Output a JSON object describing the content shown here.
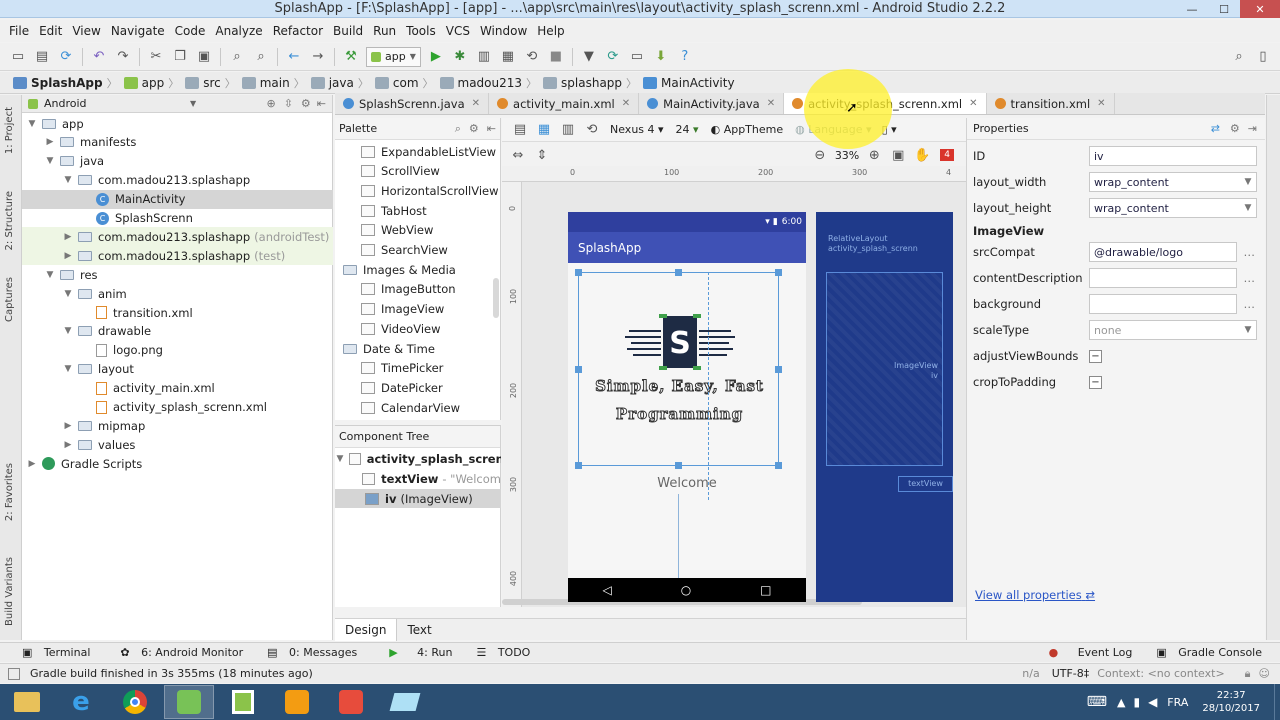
{
  "window": {
    "title": "SplashApp - [F:\\SplashApp] - [app] - ...\\app\\src\\main\\res\\layout\\activity_splash_screnn.xml - Android Studio 2.2.2"
  },
  "menu": [
    "File",
    "Edit",
    "View",
    "Navigate",
    "Code",
    "Analyze",
    "Refactor",
    "Build",
    "Run",
    "Tools",
    "VCS",
    "Window",
    "Help"
  ],
  "toolbar": {
    "run_config": "app"
  },
  "breadcrumb": [
    "SplashApp",
    "app",
    "src",
    "main",
    "java",
    "com",
    "madou213",
    "splashapp",
    "MainActivity"
  ],
  "project": {
    "view_mode": "Android",
    "tree": [
      {
        "label": "app",
        "type": "folder",
        "level": 0,
        "open": true
      },
      {
        "label": "manifests",
        "type": "folder",
        "level": 1,
        "open": false
      },
      {
        "label": "java",
        "type": "folder",
        "level": 1,
        "open": true
      },
      {
        "label": "com.madou213.splashapp",
        "type": "folder",
        "level": 2,
        "open": true
      },
      {
        "label": "MainActivity",
        "type": "class",
        "level": 3,
        "selected": true
      },
      {
        "label": "SplashScrenn",
        "type": "class",
        "level": 3
      },
      {
        "label": "com.madou213.splashapp",
        "suffix": "(androidTest)",
        "type": "folder",
        "level": 2,
        "open": false,
        "test": true
      },
      {
        "label": "com.madou213.splashapp",
        "suffix": "(test)",
        "type": "folder",
        "level": 2,
        "open": false,
        "test": true
      },
      {
        "label": "res",
        "type": "folder",
        "level": 1,
        "open": true
      },
      {
        "label": "anim",
        "type": "folder",
        "level": 2,
        "open": true
      },
      {
        "label": "transition.xml",
        "type": "file",
        "level": 3
      },
      {
        "label": "drawable",
        "type": "folder",
        "level": 2,
        "open": true
      },
      {
        "label": "logo.png",
        "type": "file",
        "level": 3
      },
      {
        "label": "layout",
        "type": "folder",
        "level": 2,
        "open": true
      },
      {
        "label": "activity_main.xml",
        "type": "file",
        "level": 3
      },
      {
        "label": "activity_splash_screnn.xml",
        "type": "file",
        "level": 3
      },
      {
        "label": "mipmap",
        "type": "folder",
        "level": 2,
        "open": false
      },
      {
        "label": "values",
        "type": "folder",
        "level": 2,
        "open": false
      },
      {
        "label": "Gradle Scripts",
        "type": "gradle",
        "level": 0,
        "open": false
      }
    ]
  },
  "left_strip": [
    "1: Project",
    "2: Structure",
    "Captures",
    "2: Favorites",
    "Build Variants"
  ],
  "editor_tabs": [
    {
      "label": "SplashScrenn.java",
      "color": "#4a8fd4"
    },
    {
      "label": "activity_main.xml",
      "color": "#e08a2c"
    },
    {
      "label": "MainActivity.java",
      "color": "#4a8fd4"
    },
    {
      "label": "activity_splash_screnn.xml",
      "color": "#e08a2c",
      "active": true
    },
    {
      "label": "transition.xml",
      "color": "#e08a2c"
    }
  ],
  "palette": {
    "title": "Palette",
    "items": [
      {
        "label": "ExpandableListView",
        "indent": true
      },
      {
        "label": "ScrollView",
        "indent": true
      },
      {
        "label": "HorizontalScrollView",
        "indent": true
      },
      {
        "label": "TabHost",
        "indent": true
      },
      {
        "label": "WebView",
        "indent": true
      },
      {
        "label": "SearchView",
        "indent": true
      },
      {
        "label": "Images & Media",
        "indent": false
      },
      {
        "label": "ImageButton",
        "indent": true
      },
      {
        "label": "ImageView",
        "indent": true
      },
      {
        "label": "VideoView",
        "indent": true
      },
      {
        "label": "Date & Time",
        "indent": false
      },
      {
        "label": "TimePicker",
        "indent": true
      },
      {
        "label": "DatePicker",
        "indent": true
      },
      {
        "label": "CalendarView",
        "indent": true
      }
    ]
  },
  "component_tree": {
    "title": "Component Tree",
    "root": "activity_splash_screnn (R",
    "items": [
      {
        "name": "textView",
        "detail": "- \"Welcom"
      },
      {
        "name": "iv",
        "detail": "(ImageView)",
        "selected": true
      }
    ]
  },
  "design_toolbar": {
    "device": "Nexus 4",
    "api": "24",
    "theme": "AppTheme",
    "language": "Language",
    "zoom": "33%",
    "warnings": "4"
  },
  "ruler": {
    "h": [
      "0",
      "100",
      "200",
      "300",
      "4"
    ],
    "v": [
      "0",
      "100",
      "200",
      "300",
      "400"
    ]
  },
  "phone": {
    "time": "6:00",
    "app_title": "SplashApp",
    "logo_line1": "Simple, Easy, Fast",
    "logo_line2": "Programming",
    "welcome": "Welcome"
  },
  "blueprint": {
    "layout_label": "RelativeLayout",
    "layout_id": "activity_splash_screnn",
    "imageview_label": "ImageView",
    "imageview_id": "iv",
    "textview_label": "textView"
  },
  "properties": {
    "title": "Properties",
    "rows": [
      {
        "label": "ID",
        "value": "iv",
        "kind": "text"
      },
      {
        "label": "layout_width",
        "value": "wrap_content",
        "kind": "dropdown"
      },
      {
        "label": "layout_height",
        "value": "wrap_content",
        "kind": "dropdown"
      }
    ],
    "section": "ImageView",
    "rows2": [
      {
        "label": "srcCompat",
        "value": "@drawable/logo",
        "kind": "browse"
      },
      {
        "label": "contentDescription",
        "value": "",
        "kind": "browse"
      },
      {
        "label": "background",
        "value": "",
        "kind": "browse"
      },
      {
        "label": "scaleType",
        "value": "none",
        "kind": "dropdown"
      },
      {
        "label": "adjustViewBounds",
        "value": "−",
        "kind": "check"
      },
      {
        "label": "cropToPadding",
        "value": "−",
        "kind": "check"
      }
    ],
    "view_all": "View all properties"
  },
  "bottom_tabs": [
    "Design",
    "Text"
  ],
  "tool_windows": [
    "Terminal",
    "6: Android Monitor",
    "0: Messages",
    "4: Run",
    "TODO"
  ],
  "tool_windows_right": [
    "Event Log",
    "Gradle Console"
  ],
  "status": {
    "message": "Gradle build finished in 3s 355ms (18 minutes ago)",
    "position": "n/a",
    "encoding": "UTF-8",
    "context": "Context: <no context>"
  },
  "taskbar": {
    "time": "22:37",
    "date": "28/10/2017",
    "lang": "FRA"
  },
  "colors": {
    "primary": "#3f51b5",
    "primary_dark": "#2f3f9e",
    "blueprint": "#1f3a8a",
    "link": "#2a56c6"
  }
}
